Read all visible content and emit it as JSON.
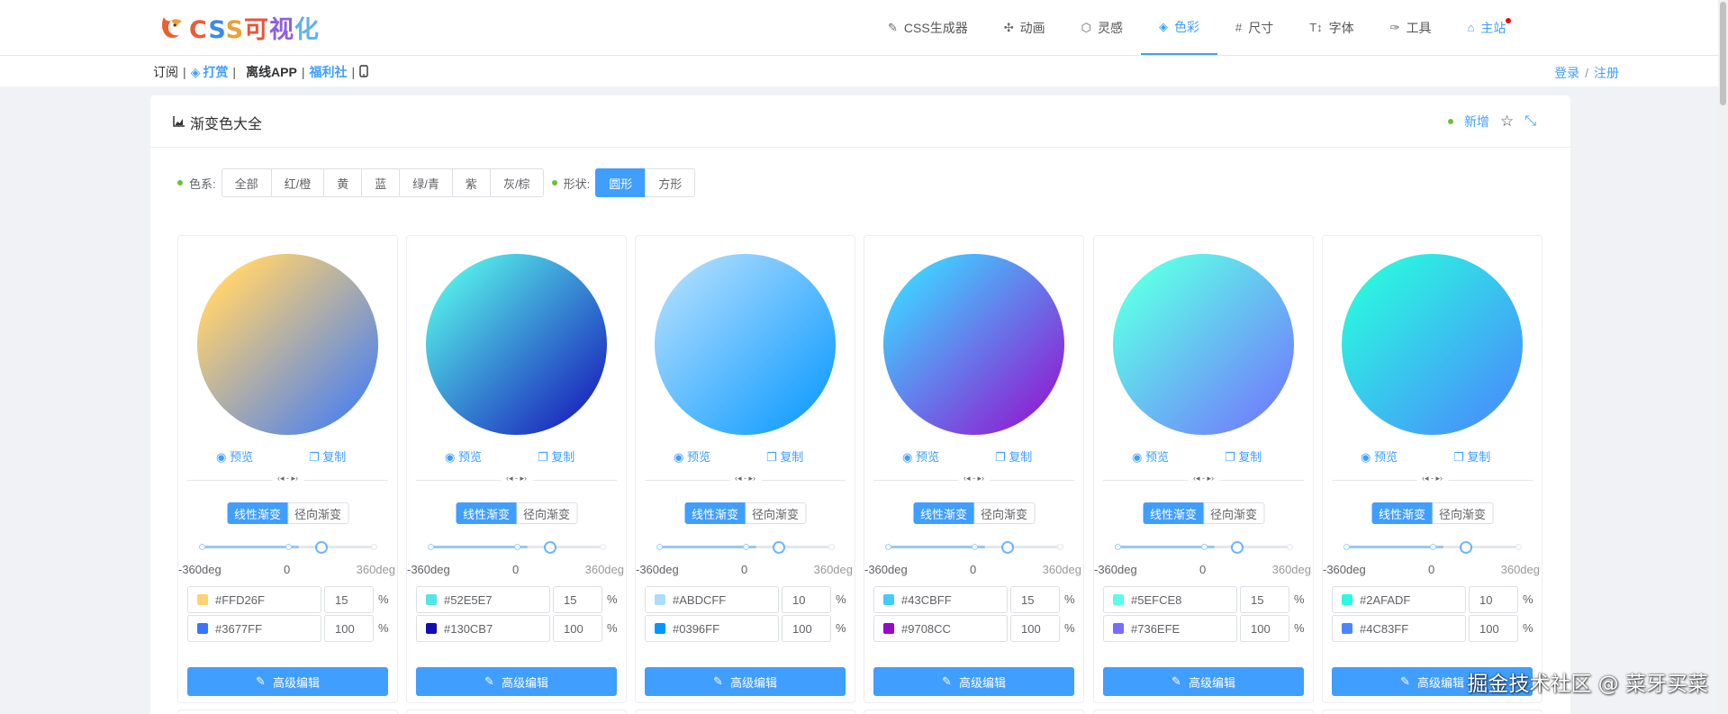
{
  "brand": {
    "logo_text": [
      "C",
      "S",
      "S",
      "可",
      "视",
      "化"
    ]
  },
  "nav": {
    "items": [
      {
        "label": "CSS生成器",
        "icon": "edit-square-icon",
        "glyph": "✎"
      },
      {
        "label": "动画",
        "icon": "animation-icon",
        "glyph": "✣"
      },
      {
        "label": "灵感",
        "icon": "cube-icon",
        "glyph": "⬡"
      },
      {
        "label": "色彩",
        "icon": "paint-bucket-icon",
        "glyph": "◈",
        "active": true
      },
      {
        "label": "尺寸",
        "icon": "hash-icon",
        "glyph": "#"
      },
      {
        "label": "字体",
        "icon": "text-size-icon",
        "glyph": "T↕"
      },
      {
        "label": "工具",
        "icon": "wrench-icon",
        "glyph": "✑"
      },
      {
        "label": "主站",
        "icon": "home-icon",
        "glyph": "⌂"
      }
    ]
  },
  "subnav": {
    "subscribe": "订阅",
    "reward": "打赏",
    "offline_app": "离线APP",
    "welfare": "福利社",
    "separator": "|"
  },
  "auth": {
    "login": "登录",
    "slash": "/",
    "register": "注册"
  },
  "panel": {
    "title": "渐变色大全",
    "add": "新增",
    "star_glyph": "☆",
    "shrink_glyph": "⤡"
  },
  "filters": {
    "color_label": "色系:",
    "colors": [
      "全部",
      "红/橙",
      "黄",
      "蓝",
      "绿/青",
      "紫",
      "灰/棕"
    ],
    "shape_label": "形状:",
    "shapes": [
      "圆形",
      "方形"
    ],
    "active_shape": 0
  },
  "card_labels": {
    "preview": "预览",
    "copy": "复制",
    "linear": "线性渐变",
    "radial": "径向渐变",
    "min": "-360deg",
    "mid": "0",
    "max": "360deg",
    "unit": "%",
    "edit": "高级编辑",
    "divider_mark": "‹◂  -  ▸›"
  },
  "gradients": [
    {
      "color1": "#FFD26F",
      "pct1": "15",
      "color2": "#3677FF",
      "pct2": "100"
    },
    {
      "color1": "#52E5E7",
      "pct1": "15",
      "color2": "#130CB7",
      "pct2": "100"
    },
    {
      "color1": "#ABDCFF",
      "pct1": "10",
      "color2": "#0396FF",
      "pct2": "100"
    },
    {
      "color1": "#43CBFF",
      "pct1": "15",
      "color2": "#9708CC",
      "pct2": "100"
    },
    {
      "color1": "#5EFCE8",
      "pct1": "15",
      "color2": "#736EFE",
      "pct2": "100"
    },
    {
      "color1": "#2AFADF",
      "pct1": "10",
      "color2": "#4C83FF",
      "pct2": "100"
    }
  ],
  "watermark": "掘金技术社区 @ 菜牙买菜"
}
